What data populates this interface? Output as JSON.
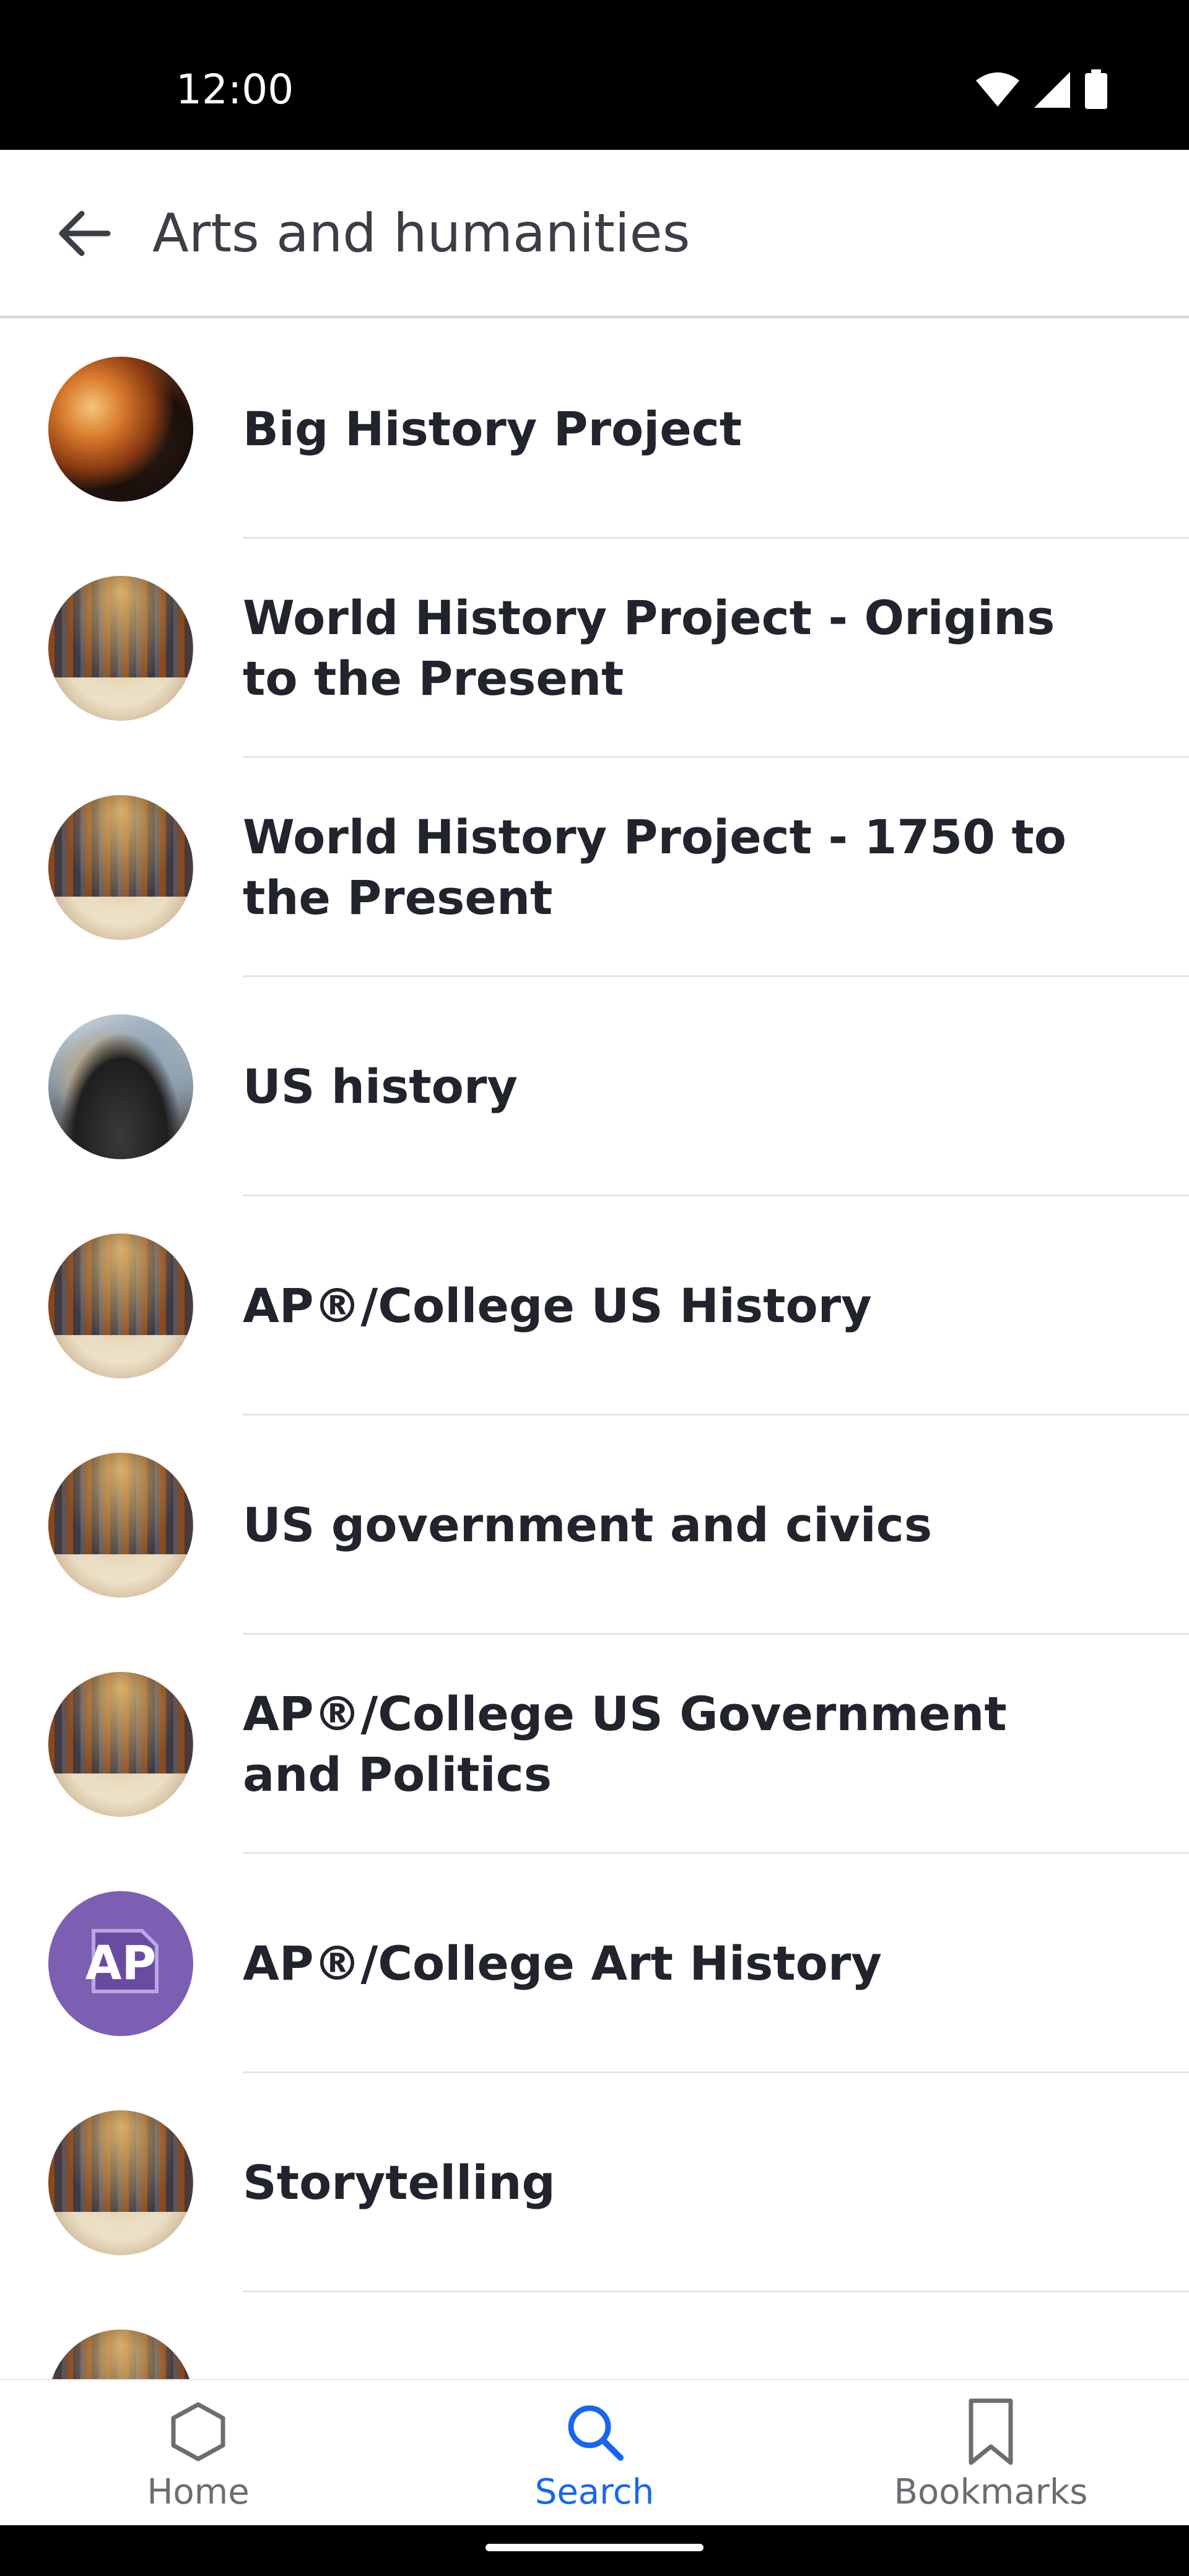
{
  "status_bar": {
    "time": "12:00",
    "icons": [
      "wifi-icon",
      "cellular-icon",
      "battery-icon"
    ]
  },
  "app_bar": {
    "back_icon": "arrow-left-icon",
    "title": "Arts and humanities"
  },
  "courses": [
    {
      "title": "Big History Project",
      "thumbnail": "space"
    },
    {
      "title": "World History Project - Origins to the Present",
      "thumbnail": "library"
    },
    {
      "title": "World History Project - 1750 to the Present",
      "thumbnail": "library"
    },
    {
      "title": "US history",
      "thumbnail": "painting"
    },
    {
      "title": "AP®/College US History",
      "thumbnail": "library"
    },
    {
      "title": "US government and civics",
      "thumbnail": "library"
    },
    {
      "title": "AP®/College US Government and Politics",
      "thumbnail": "library"
    },
    {
      "title": "AP®/College Art History",
      "thumbnail": "ap-badge",
      "badge_text": "AP"
    },
    {
      "title": "Storytelling",
      "thumbnail": "library"
    },
    {
      "title": "",
      "thumbnail": "library"
    }
  ],
  "bottom_nav": {
    "tabs": [
      {
        "label": "Home",
        "icon": "hexagon-icon",
        "active": false
      },
      {
        "label": "Search",
        "icon": "search-icon",
        "active": true
      },
      {
        "label": "Bookmarks",
        "icon": "bookmark-icon",
        "active": false
      }
    ]
  },
  "colors": {
    "accent": "#1865f2",
    "ap_badge": "#7c5fb3",
    "text_primary": "#21242c",
    "text_secondary": "#6b6d72"
  }
}
